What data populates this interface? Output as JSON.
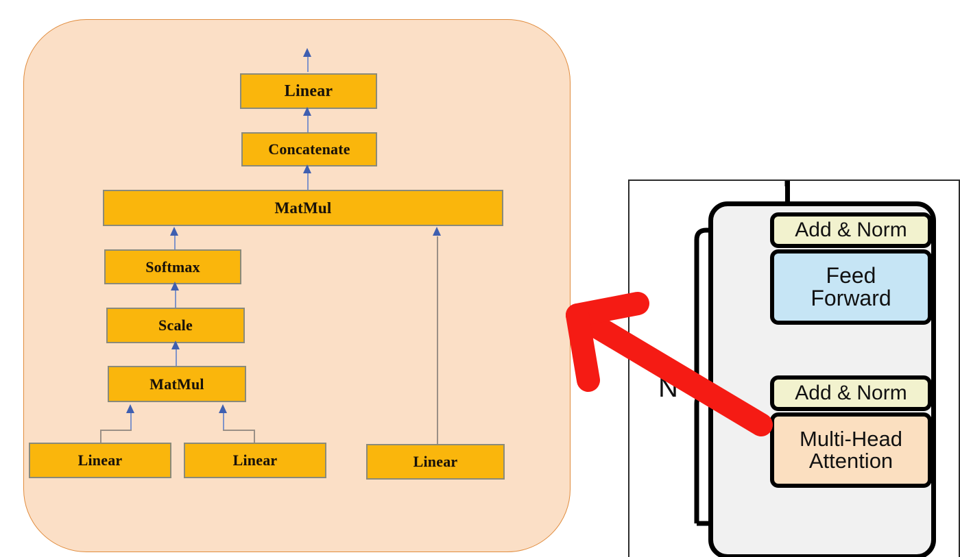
{
  "figure": {
    "title": "Scaled Dot-Product / Multi-Head Attention detail with Transformer encoder block callout",
    "colors": {
      "panel_fill": "#fbdfc6",
      "panel_border": "#e08b3c",
      "box_fill": "#fab60c",
      "box_border": "#8a8a7a",
      "arrow_blue": "#3f5fb0",
      "connector_gray": "#9a8f86",
      "annotation_red": "#f51b14",
      "add_norm_fill": "#f2f2ce",
      "feed_forward_fill": "#c6e5f5",
      "multi_head_fill": "#fbdfc0",
      "encoder_stack_fill": "#f1f1f1",
      "encoder_outline": "#000000"
    }
  },
  "attention_detail": {
    "panel_name": "multi-head-attention-detail",
    "boxes": {
      "output_linear": "Linear",
      "concatenate": "Concatenate",
      "matmul_top": "MatMul",
      "softmax": "Softmax",
      "scale": "Scale",
      "matmul_qk": "MatMul",
      "linear_q": "Linear",
      "linear_k": "Linear",
      "linear_v": "Linear"
    }
  },
  "encoder_block": {
    "panel_name": "transformer-encoder-block",
    "repeat_label": "N",
    "boxes": {
      "add_norm_top": "Add & Norm",
      "feed_forward": "Feed\nForward",
      "feed_forward_line1": "Feed",
      "feed_forward_line2": "Forward",
      "add_norm_bottom": "Add & Norm",
      "multi_head_line1": "Multi-Head",
      "multi_head_line2": "Attention"
    }
  },
  "annotation": {
    "arrow_name": "red-callout-arrow",
    "direction": "up-left",
    "color": "#f51b14"
  }
}
